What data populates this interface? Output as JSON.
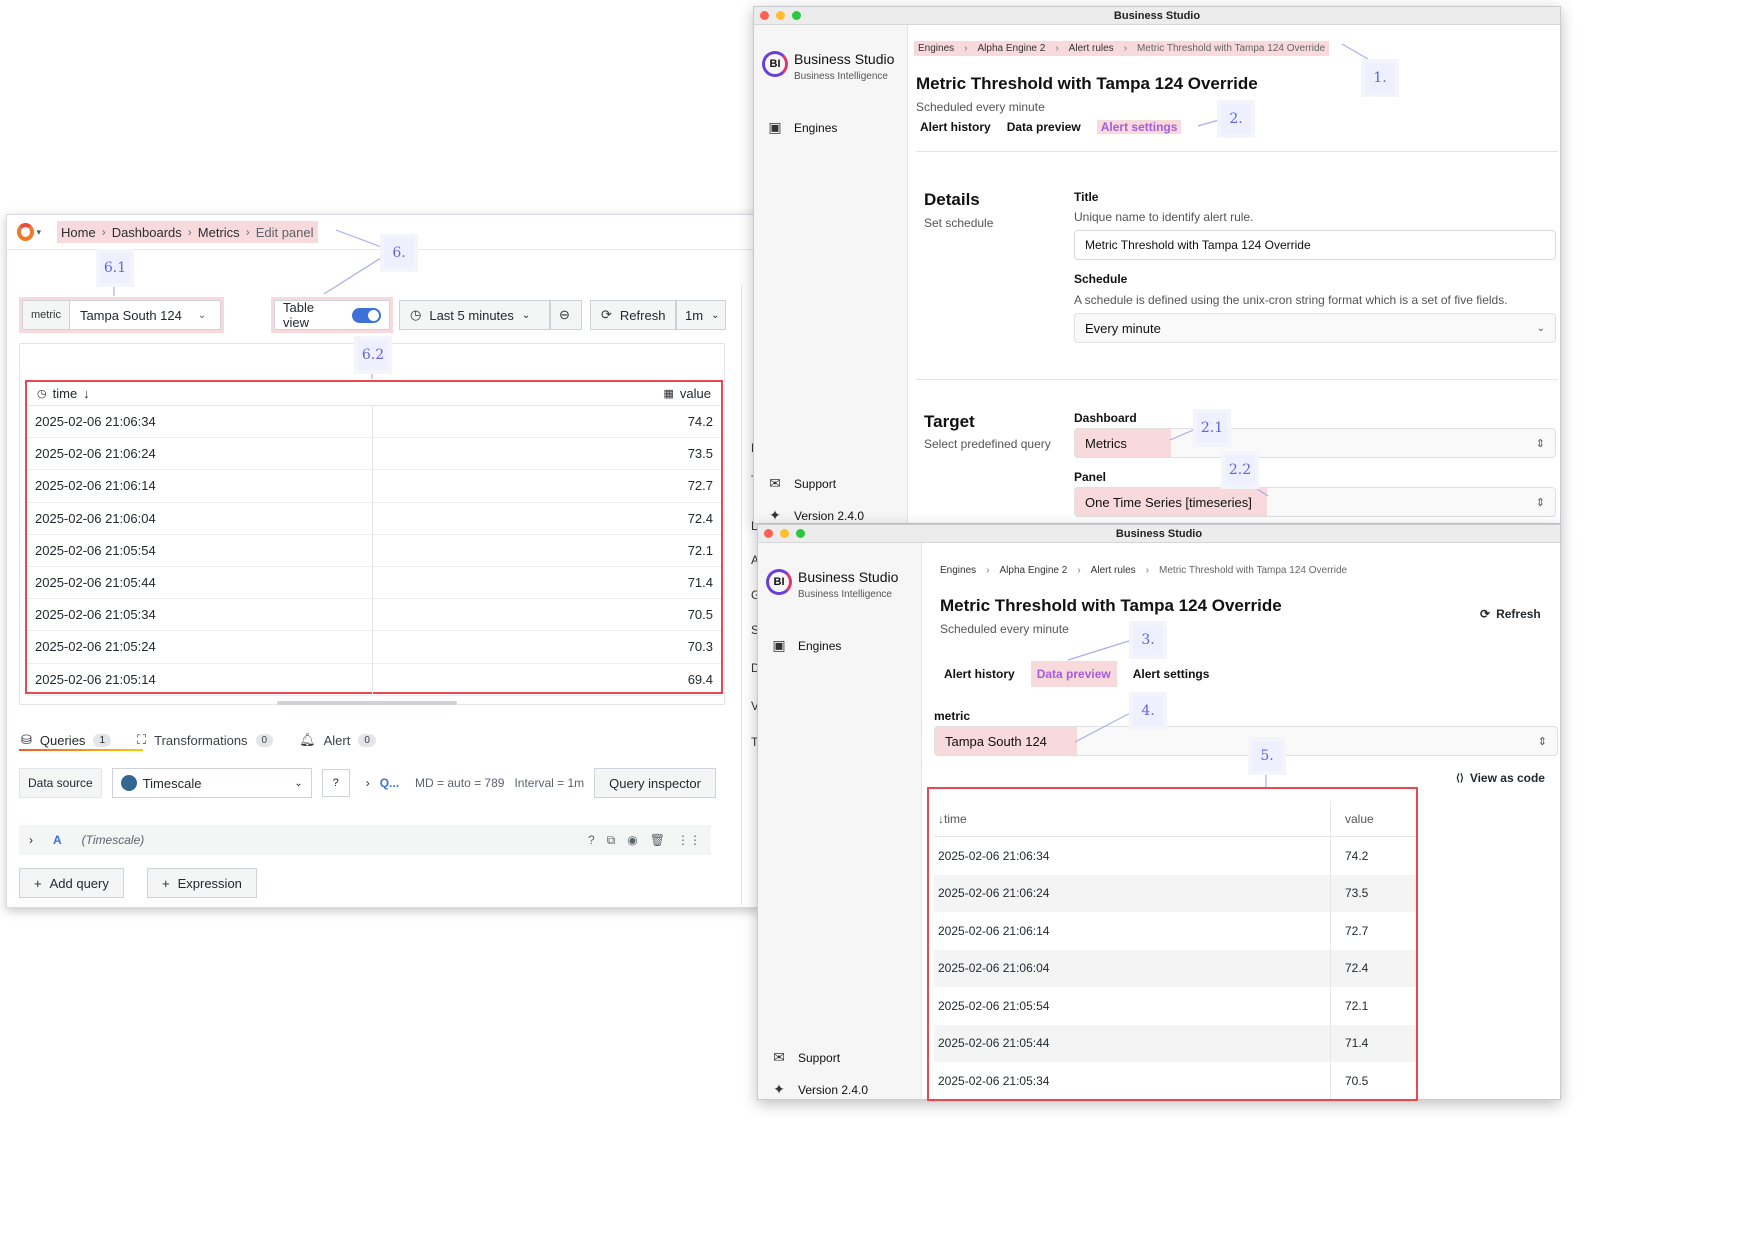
{
  "dashboard": {
    "breadcrumbs": [
      "Home",
      "Dashboards",
      "Metrics",
      "Edit panel"
    ],
    "variable": {
      "label": "metric",
      "value": "Tampa South 124"
    },
    "table_view_label": "Table view",
    "time_range": "Last 5 minutes",
    "refresh_label": "Refresh",
    "refresh_interval": "1m",
    "table": {
      "columns": [
        "time",
        "value"
      ],
      "rows": [
        [
          "2025-02-06 21:06:34",
          "74.2"
        ],
        [
          "2025-02-06 21:06:24",
          "73.5"
        ],
        [
          "2025-02-06 21:06:14",
          "72.7"
        ],
        [
          "2025-02-06 21:06:04",
          "72.4"
        ],
        [
          "2025-02-06 21:05:54",
          "72.1"
        ],
        [
          "2025-02-06 21:05:44",
          "71.4"
        ],
        [
          "2025-02-06 21:05:34",
          "70.5"
        ],
        [
          "2025-02-06 21:05:24",
          "70.3"
        ],
        [
          "2025-02-06 21:05:14",
          "69.4"
        ]
      ]
    },
    "tabs": [
      {
        "label": "Queries",
        "count": "1"
      },
      {
        "label": "Transformations",
        "count": "0"
      },
      {
        "label": "Alert",
        "count": "0"
      }
    ],
    "data_source_label": "Data source",
    "data_source": "Timescale",
    "query_link": "Q...",
    "md_info": "MD = auto = 789",
    "interval_info": "Interval = 1m",
    "query_inspector_label": "Query inspector",
    "query_letter": "A",
    "query_source": "(Timescale)",
    "add_query_label": "Add query",
    "expression_label": "Expression",
    "rail_letters": [
      "P",
      "T",
      "L",
      "A",
      "G",
      "S",
      "D",
      "V",
      "T"
    ]
  },
  "studio_top": {
    "window_title": "Business Studio",
    "brand": "Business Studio",
    "brand_sub": "Business Intelligence",
    "nav_engines": "Engines",
    "support": "Support",
    "version": "Version 2.4.0",
    "breadcrumbs": [
      "Engines",
      "Alpha Engine 2",
      "Alert rules",
      "Metric Threshold with Tampa 124 Override"
    ],
    "title": "Metric Threshold with Tampa 124 Override",
    "subtitle": "Scheduled every minute",
    "tabs": [
      "Alert history",
      "Data preview",
      "Alert settings"
    ],
    "details_title": "Details",
    "details_sub": "Set schedule",
    "title_label": "Title",
    "title_help": "Unique name to identify alert rule.",
    "title_value": "Metric Threshold with Tampa 124 Override",
    "schedule_label": "Schedule",
    "schedule_help": "A schedule is defined using the unix-cron string format which is a set of five fields.",
    "schedule_value": "Every minute",
    "target_title": "Target",
    "target_sub": "Select predefined query",
    "dashboard_label": "Dashboard",
    "dashboard_value": "Metrics",
    "panel_label": "Panel",
    "panel_value": "One Time Series [timeseries]"
  },
  "studio_bottom": {
    "window_title": "Business Studio",
    "brand": "Business Studio",
    "brand_sub": "Business Intelligence",
    "nav_engines": "Engines",
    "support": "Support",
    "version": "Version 2.4.0",
    "breadcrumbs": [
      "Engines",
      "Alpha Engine 2",
      "Alert rules",
      "Metric Threshold with Tampa 124 Override"
    ],
    "title": "Metric Threshold with Tampa 124 Override",
    "subtitle": "Scheduled every minute",
    "refresh_label": "Refresh",
    "tabs": [
      "Alert history",
      "Data preview",
      "Alert settings"
    ],
    "metric_label": "metric",
    "metric_value": "Tampa South 124",
    "view_as_code": "View as code",
    "table": {
      "columns": [
        "time",
        "value"
      ],
      "rows": [
        [
          "2025-02-06 21:06:34",
          "74.2"
        ],
        [
          "2025-02-06 21:06:24",
          "73.5"
        ],
        [
          "2025-02-06 21:06:14",
          "72.7"
        ],
        [
          "2025-02-06 21:06:04",
          "72.4"
        ],
        [
          "2025-02-06 21:05:54",
          "72.1"
        ],
        [
          "2025-02-06 21:05:44",
          "71.4"
        ],
        [
          "2025-02-06 21:05:34",
          "70.5"
        ]
      ]
    }
  },
  "callouts": [
    "1.",
    "2.",
    "2.1",
    "2.2",
    "3.",
    "4.",
    "5.",
    "6.",
    "6.1",
    "6.2"
  ],
  "colors": {
    "highlight": "#f8d9dc",
    "red_frame": "#e8484e",
    "callout_text": "#6266d8",
    "active_tab": "#a35de0"
  }
}
